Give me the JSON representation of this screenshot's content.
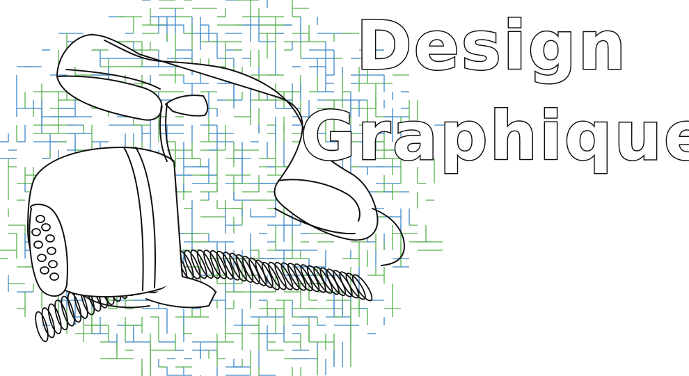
{
  "title": {
    "line1": "Design",
    "line2": "Graphique"
  },
  "colors": {
    "background": "#ffffff",
    "maze_green": "#55b04a",
    "maze_blue": "#3a86c8",
    "outline": "#111111",
    "title_fill": "#ffffff"
  },
  "illustration": {
    "subject": "telephone-icon",
    "style": "line-art"
  }
}
